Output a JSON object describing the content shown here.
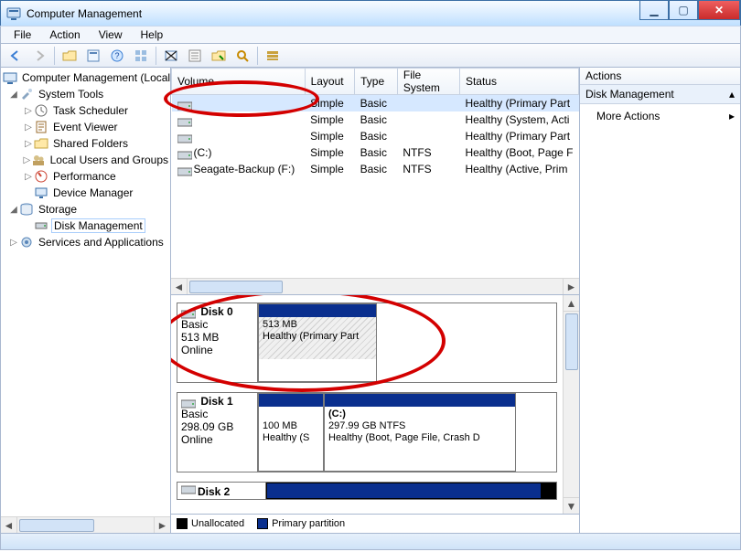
{
  "window": {
    "title": "Computer Management"
  },
  "menu": {
    "file": "File",
    "action": "Action",
    "view": "View",
    "help": "Help"
  },
  "tree": {
    "root": "Computer Management (Local",
    "systemTools": "System Tools",
    "children": {
      "taskScheduler": "Task Scheduler",
      "eventViewer": "Event Viewer",
      "sharedFolders": "Shared Folders",
      "localUsers": "Local Users and Groups",
      "performance": "Performance",
      "deviceManager": "Device Manager"
    },
    "storage": "Storage",
    "diskManagement": "Disk Management",
    "services": "Services and Applications"
  },
  "table": {
    "headers": {
      "volume": "Volume",
      "layout": "Layout",
      "type": "Type",
      "fs": "File System",
      "status": "Status"
    },
    "rows": [
      {
        "volume": "",
        "layout": "Simple",
        "type": "Basic",
        "fs": "",
        "status": "Healthy (Primary Part"
      },
      {
        "volume": "",
        "layout": "Simple",
        "type": "Basic",
        "fs": "",
        "status": "Healthy (System, Acti"
      },
      {
        "volume": "",
        "layout": "Simple",
        "type": "Basic",
        "fs": "",
        "status": "Healthy (Primary Part"
      },
      {
        "volume": "(C:)",
        "layout": "Simple",
        "type": "Basic",
        "fs": "NTFS",
        "status": "Healthy (Boot, Page F"
      },
      {
        "volume": "Seagate-Backup (F:)",
        "layout": "Simple",
        "type": "Basic",
        "fs": "NTFS",
        "status": "Healthy (Active, Prim"
      }
    ]
  },
  "disks": {
    "d0": {
      "title": "Disk 0",
      "kind": "Basic",
      "size": "513 MB",
      "state": "Online",
      "p0": {
        "size": "513 MB",
        "status": "Healthy (Primary Part"
      }
    },
    "d1": {
      "title": "Disk 1",
      "kind": "Basic",
      "size": "298.09 GB",
      "state": "Online",
      "p0": {
        "size": "100 MB",
        "status": "Healthy (S"
      },
      "p1": {
        "label": "(C:)",
        "size": "297.99 GB NTFS",
        "status": "Healthy (Boot, Page File, Crash D"
      }
    },
    "d2": {
      "title": "Disk 2"
    }
  },
  "legend": {
    "unalloc": "Unallocated",
    "primary": "Primary partition"
  },
  "actions": {
    "title": "Actions",
    "section": "Disk Management",
    "more": "More Actions"
  }
}
